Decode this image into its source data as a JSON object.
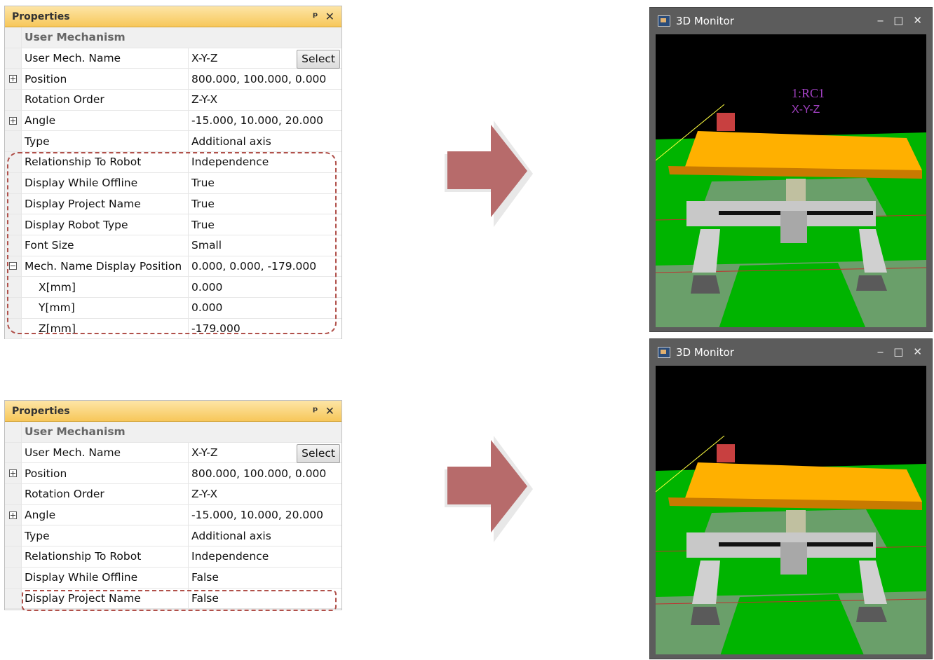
{
  "panel_top": {
    "title": "Properties",
    "pin": "̧",
    "close": "✕",
    "category": "User Mechanism",
    "select_label": "Select",
    "rows": [
      {
        "name": "User Mech. Name",
        "value": "X-Y-Z"
      },
      {
        "name": "Position",
        "value": "800.000, 100.000, 0.000"
      },
      {
        "name": "Rotation Order",
        "value": "Z-Y-X"
      },
      {
        "name": "Angle",
        "value": "-15.000, 10.000, 20.000"
      },
      {
        "name": "Type",
        "value": "Additional axis"
      },
      {
        "name": "Relationship To Robot",
        "value": "Independence"
      },
      {
        "name": "Display While Offline",
        "value": "True"
      },
      {
        "name": "Display Project Name",
        "value": "True"
      },
      {
        "name": "Display Robot Type",
        "value": "True"
      },
      {
        "name": "Font Size",
        "value": "Small"
      },
      {
        "name": "Mech. Name Display Position",
        "value": "0.000, 0.000, -179.000"
      },
      {
        "name": "X[mm]",
        "value": "0.000"
      },
      {
        "name": "Y[mm]",
        "value": "0.000"
      },
      {
        "name": "Z[mm]",
        "value": "-179.000"
      }
    ]
  },
  "panel_bottom": {
    "title": "Properties",
    "category": "User Mechanism",
    "select_label": "Select",
    "rows": [
      {
        "name": "User Mech. Name",
        "value": "X-Y-Z"
      },
      {
        "name": "Position",
        "value": "800.000, 100.000, 0.000"
      },
      {
        "name": "Rotation Order",
        "value": "Z-Y-X"
      },
      {
        "name": "Angle",
        "value": "-15.000, 10.000, 20.000"
      },
      {
        "name": "Type",
        "value": "Additional axis"
      },
      {
        "name": "Relationship To Robot",
        "value": "Independence"
      },
      {
        "name": "Display While Offline",
        "value": "False"
      },
      {
        "name": "Display Project Name",
        "value": "False"
      }
    ]
  },
  "monitor_top": {
    "title": "3D Monitor",
    "label_line1": "1:RC1",
    "label_line2": "X-Y-Z"
  },
  "monitor_bottom": {
    "title": "3D Monitor"
  },
  "colors": {
    "arrow": "#b76b6b",
    "highlight": "#b0504a",
    "table": "#ffb000",
    "floor_green": "#00b400",
    "floor_gray": "#6a9f6a",
    "label": "#a040c0"
  }
}
